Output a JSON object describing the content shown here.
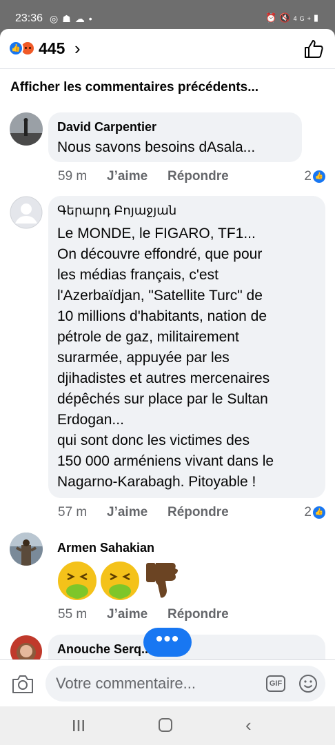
{
  "status_bar": {
    "time": "23:36",
    "left_icons": [
      "whatsapp-icon",
      "contacts-icon",
      "cloud-icon",
      "dot-icon"
    ],
    "right_icons": [
      "alarm-icon",
      "mute-icon",
      "signal-4g-icon",
      "battery-icon"
    ],
    "network": "4G+"
  },
  "header": {
    "reactions": [
      "like",
      "angry"
    ],
    "reaction_count": "445",
    "chevron": "›"
  },
  "previous_comments_label": "Afficher les commentaires précédents...",
  "comments": [
    {
      "author": "David Carpentier",
      "text": "Nous savons besoins dAsala...",
      "time": "59 m",
      "like_label": "J’aime",
      "reply_label": "Répondre",
      "reaction_count": "2"
    },
    {
      "author": "Գերարդ Բոյաջյան",
      "text": "Le MONDE, le FIGARO, TF1...\nOn découvre effondré, que pour\nles médias français, c'est\nl'Azerbaïdjan, \"Satellite Turc\" de\n10 millions d'habitants, nation de\npétrole de gaz, militairement\nsurarmée, appuyée par les\ndjihadistes et autres mercenaires\ndépêchés sur place par le Sultan\nErdogan...\nqui sont donc les victimes des\n150 000 arméniens vivant dans le\nNagarno-Karabagh. Pitoyable !",
      "time": "57 m",
      "like_label": "J’aime",
      "reply_label": "Répondre",
      "reaction_count": "2"
    },
    {
      "author": "Armen Sahakian",
      "stickers": [
        "vomiting-face-emoji",
        "vomiting-face-emoji",
        "thumbs-down-emoji"
      ],
      "time": "55 m",
      "like_label": "J’aime",
      "reply_label": "Répondre"
    },
    {
      "author": "Anouche Serq..."
    }
  ],
  "more_button": "•••",
  "composer": {
    "placeholder": "Votre commentaire...",
    "gif_label": "GIF"
  },
  "nav": {
    "back": "‹"
  }
}
